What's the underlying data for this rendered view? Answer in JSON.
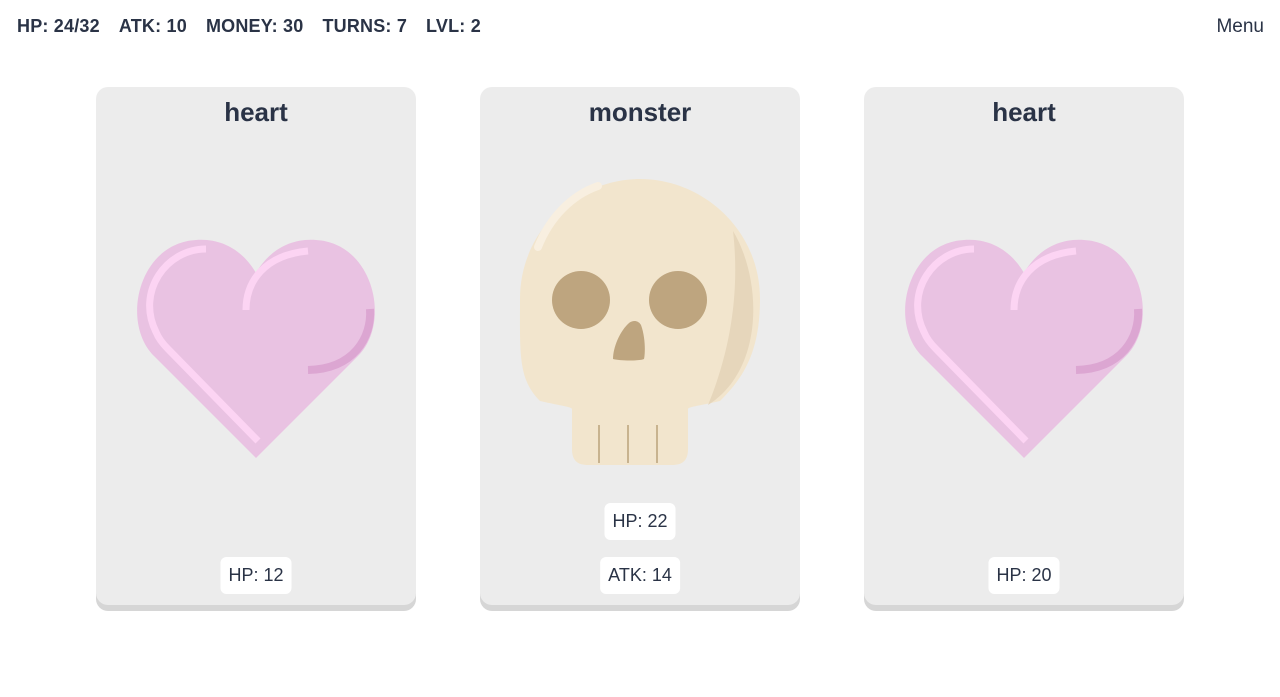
{
  "stats": {
    "hp": "HP: 24/32",
    "atk": "ATK: 10",
    "money": "MONEY: 30",
    "turns": "TURNS: 7",
    "lvl": "LVL: 2"
  },
  "menu_label": "Menu",
  "cards": [
    {
      "title": "heart",
      "icon": "heart-icon",
      "hp": "HP: 12"
    },
    {
      "title": "monster",
      "icon": "skull-icon",
      "hp": "HP: 22",
      "atk": "ATK: 14"
    },
    {
      "title": "heart",
      "icon": "heart-icon",
      "hp": "HP: 20"
    }
  ],
  "colors": {
    "heart": "#e9c2e2",
    "heart_highlight": "#fcd4f3",
    "heart_shadow": "#dca6d2",
    "skull": "#f2e5cd",
    "skull_shadow": "#e6d6bb",
    "skull_eyes": "#bea57f",
    "card_bg": "#ececec",
    "text": "#2a3346"
  }
}
